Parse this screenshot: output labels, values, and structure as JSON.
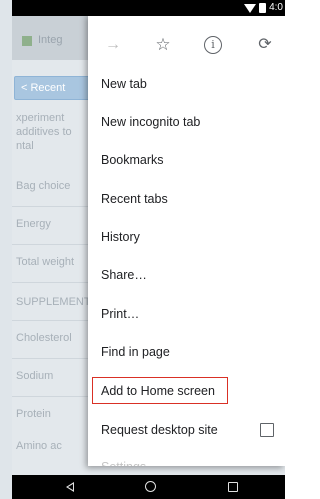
{
  "status_bar": {
    "time": "4:0",
    "icons": [
      "wifi-icon",
      "battery-icon"
    ]
  },
  "background_page": {
    "tab_text": "Integ",
    "button_label": "< Recent",
    "lines": [
      "xperiment",
      "additives to",
      "ntal",
      "Bag choice",
      "Energy",
      "Total weight",
      "SUPPLEMENT",
      "Cholesterol",
      "Sodium",
      "Protein",
      "Amino ac"
    ]
  },
  "menu": {
    "toolbar_icons": [
      "forward-arrow-icon",
      "star-icon",
      "info-icon",
      "refresh-icon"
    ],
    "toolbar_glyphs": {
      "forward": "→",
      "star": "☆",
      "info": "i",
      "refresh": "⟳"
    },
    "items": [
      {
        "label": "New tab"
      },
      {
        "label": "New incognito tab"
      },
      {
        "label": "Bookmarks"
      },
      {
        "label": "Recent tabs"
      },
      {
        "label": "History"
      },
      {
        "label": "Share…"
      },
      {
        "label": "Print…"
      },
      {
        "label": "Find in page"
      },
      {
        "label": "Add to Home screen",
        "highlighted": true
      },
      {
        "label": "Request desktop site",
        "checkbox": false
      },
      {
        "label": "Settings"
      }
    ],
    "highlight_color": "#d93025"
  },
  "nav_bar": {
    "icons": [
      "back-icon",
      "home-icon",
      "recents-icon"
    ]
  }
}
